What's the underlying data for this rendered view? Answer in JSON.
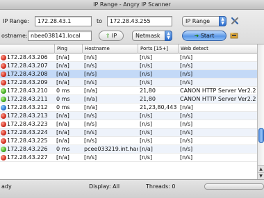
{
  "window": {
    "title": "IP Range - Angry IP Scanner"
  },
  "toolbar": {
    "ip_range_label": "IP Range:",
    "start_ip": "172.28.43.1",
    "to_label": "to",
    "end_ip": "172.28.43.255",
    "feeder_select": "IP Range",
    "hostname_label": "ostname:",
    "hostname_value": "nbee038141.local",
    "ip_button": "IP",
    "netmask_select": "Netmask",
    "start_button": "Start"
  },
  "table": {
    "columns": [
      "Ping",
      "Hostname",
      "Ports [15+]",
      "Web detect"
    ],
    "rows": [
      {
        "ip": "172.28.43.206",
        "ping": "[n/a]",
        "hostname": "[n/s]",
        "ports": "[n/s]",
        "web": "[n/s]",
        "status": "dead"
      },
      {
        "ip": "172.28.43.207",
        "ping": "[n/a]",
        "hostname": "[n/s]",
        "ports": "[n/s]",
        "web": "[n/s]",
        "status": "dead"
      },
      {
        "ip": "172.28.43.208",
        "ping": "[n/a]",
        "hostname": "[n/s]",
        "ports": "[n/s]",
        "web": "[n/s]",
        "status": "dead"
      },
      {
        "ip": "172.28.43.209",
        "ping": "[n/a]",
        "hostname": "[n/s]",
        "ports": "[n/s]",
        "web": "[n/s]",
        "status": "dead"
      },
      {
        "ip": "172.28.43.210",
        "ping": "0 ms",
        "hostname": "[n/a]",
        "ports": "21,80",
        "web": "CANON HTTP Server Ver2.2",
        "status": "alive"
      },
      {
        "ip": "172.28.43.211",
        "ping": "0 ms",
        "hostname": "[n/a]",
        "ports": "21,80",
        "web": "CANON HTTP Server Ver2.2",
        "status": "alive"
      },
      {
        "ip": "172.28.43.212",
        "ping": "0 ms",
        "hostname": "[n/a]",
        "ports": "21,23,80,443",
        "web": "[n/a]",
        "status": "info"
      },
      {
        "ip": "172.28.43.213",
        "ping": "[n/a]",
        "hostname": "[n/s]",
        "ports": "[n/s]",
        "web": "[n/s]",
        "status": "dead"
      },
      {
        "ip": "172.28.43.223",
        "ping": "[n/a]",
        "hostname": "[n/s]",
        "ports": "[n/s]",
        "web": "[n/s]",
        "status": "dead"
      },
      {
        "ip": "172.28.43.224",
        "ping": "[n/a]",
        "hostname": "[n/s]",
        "ports": "[n/s]",
        "web": "[n/s]",
        "status": "dead"
      },
      {
        "ip": "172.28.43.225",
        "ping": "[n/a]",
        "hostname": "[n/s]",
        "ports": "[n/s]",
        "web": "[n/s]",
        "status": "dead"
      },
      {
        "ip": "172.28.43.226",
        "ping": "0 ms",
        "hostname": "pcee033219.int.han",
        "ports": "[n/a]",
        "web": "[n/s]",
        "status": "alive"
      },
      {
        "ip": "172.28.43.227",
        "ping": "[n/a]",
        "hostname": "[n/s]",
        "ports": "[n/s]",
        "web": "[n/s]",
        "status": "dead"
      }
    ],
    "selected_row": 2
  },
  "status": {
    "state": "ady",
    "display": "Display: All",
    "threads": "Threads: 0"
  },
  "icons": {
    "prefs": "wrench-screwdriver-icon",
    "fetchers": "folder-icon",
    "start": "arrow-right-icon",
    "ip": "up-arrow-icon"
  },
  "colors": {
    "dead": "#c81e10",
    "alive": "#2f9b13",
    "info": "#1a64c4",
    "selection": "#c3d9f7"
  }
}
